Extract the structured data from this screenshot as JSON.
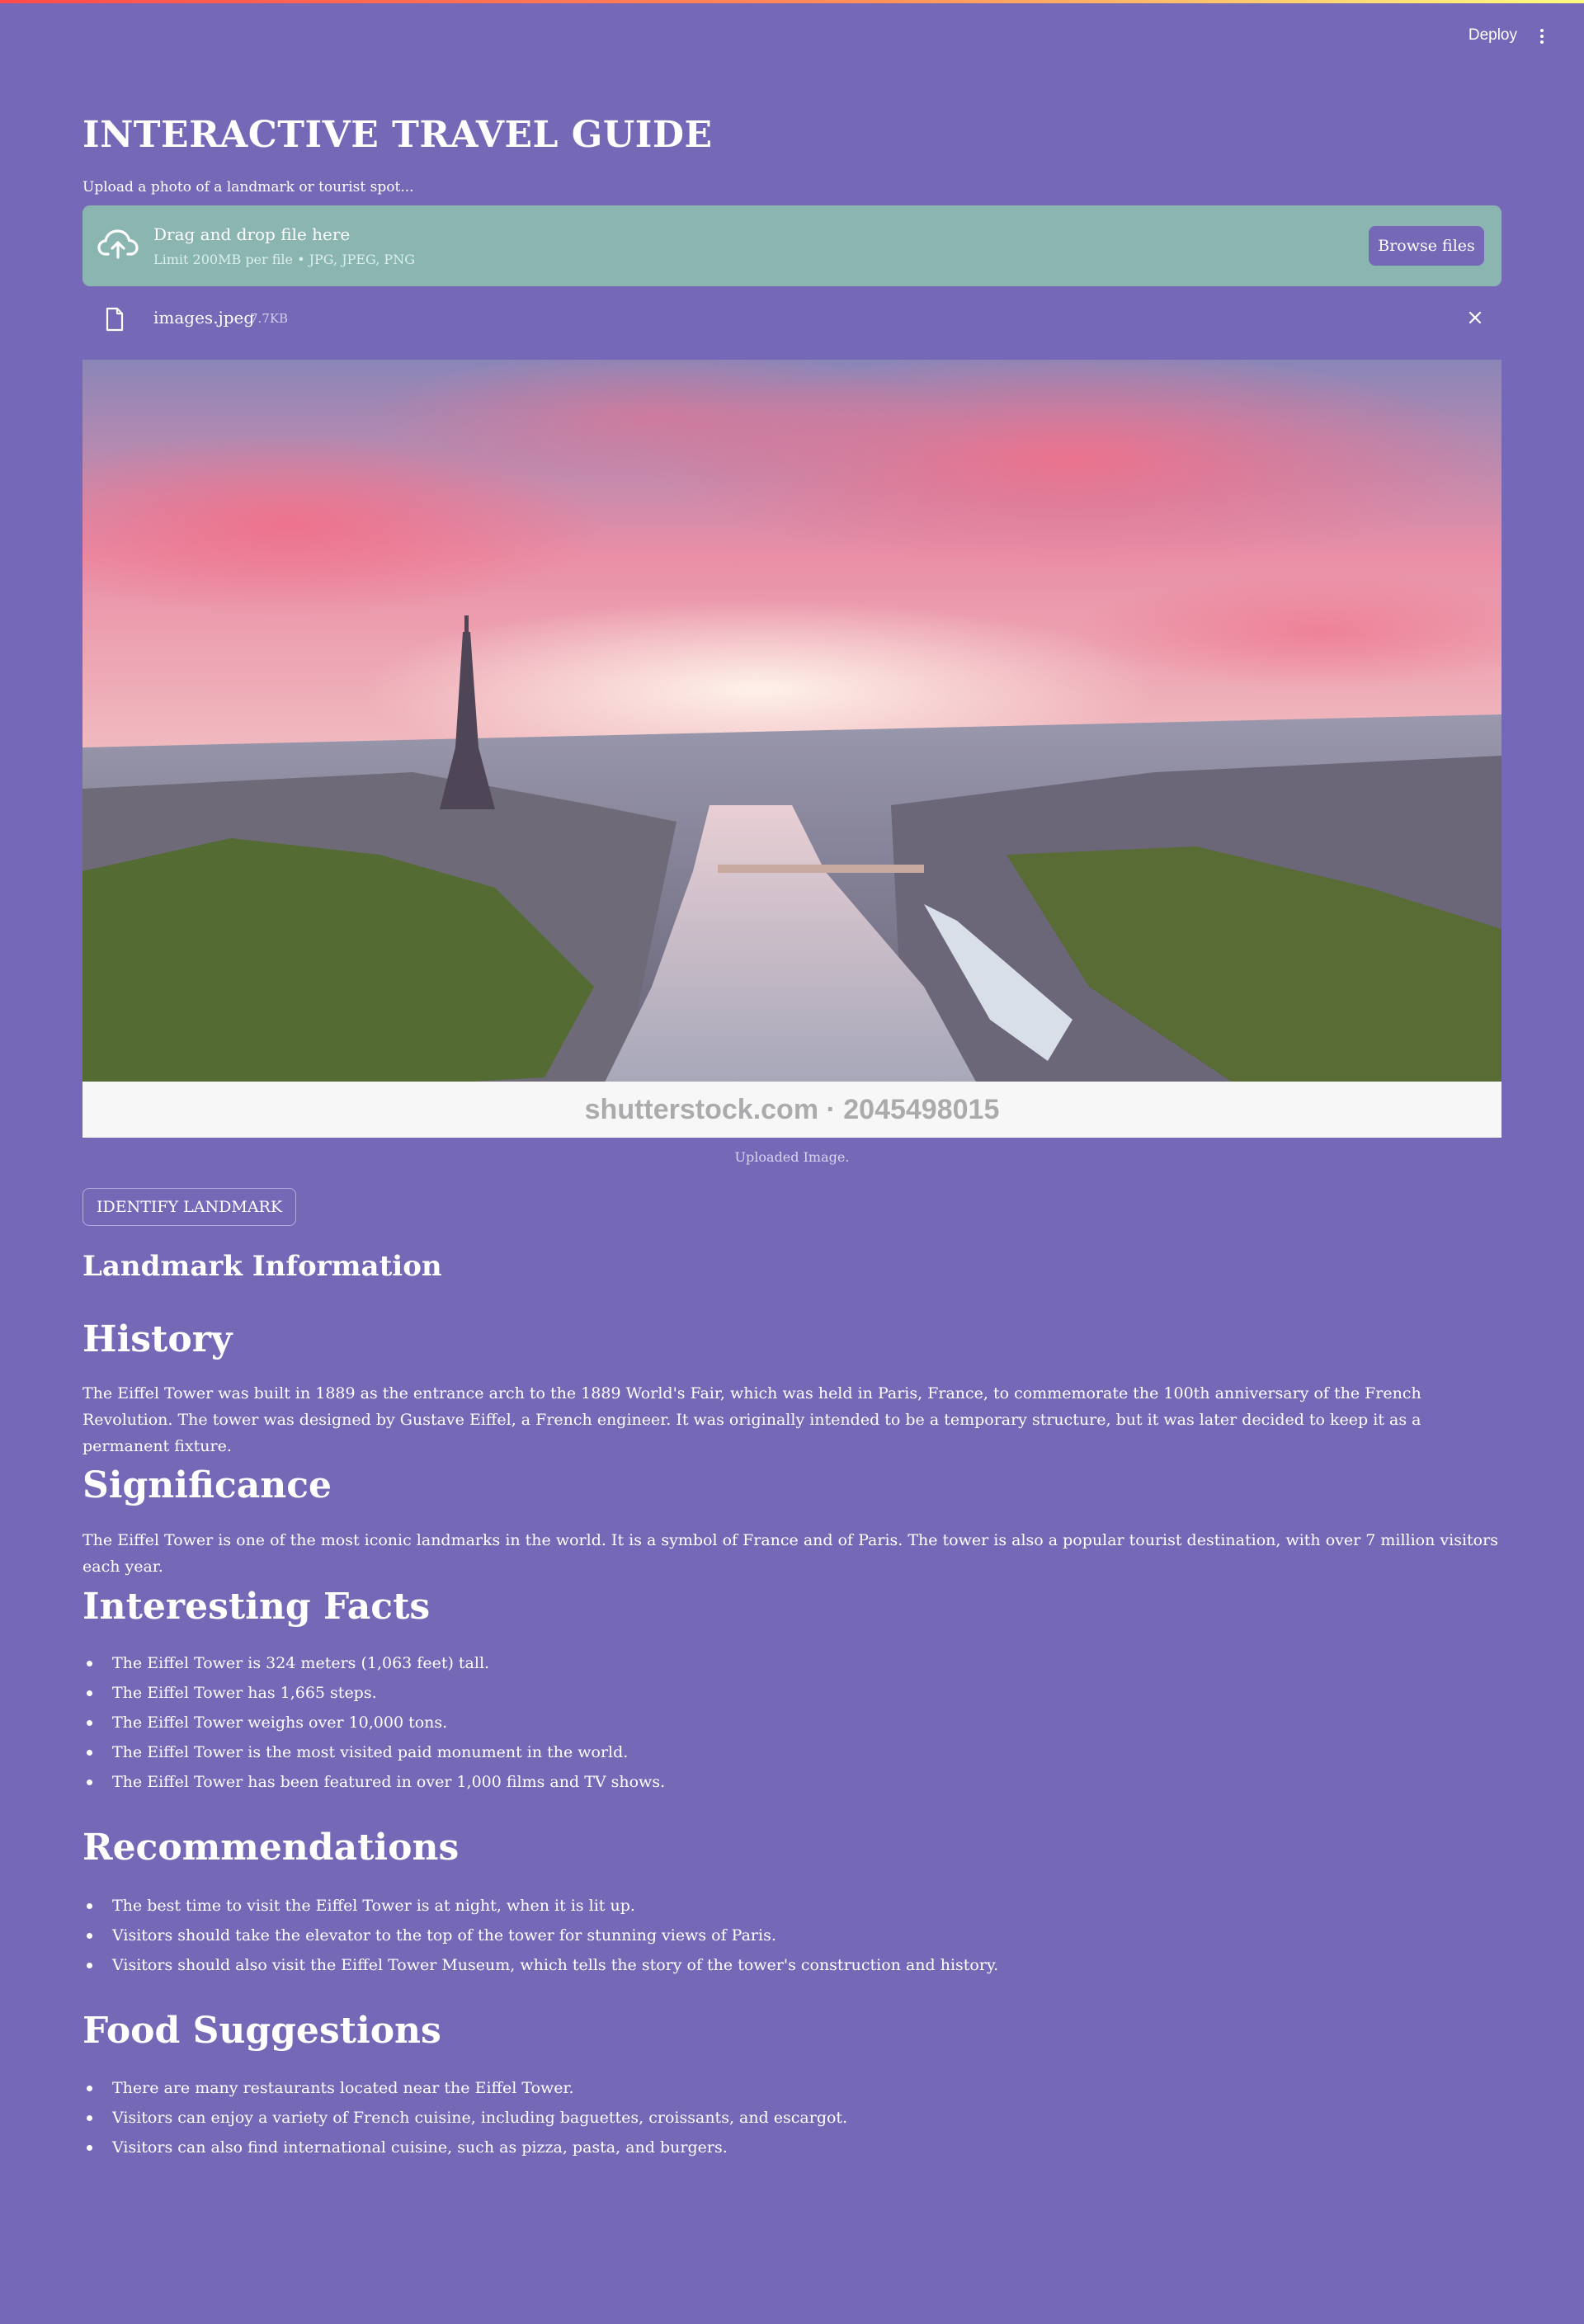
{
  "header": {
    "deploy_label": "Deploy",
    "menu_icon": "vertical-ellipsis-icon"
  },
  "page": {
    "title": "INTERACTIVE TRAVEL GUIDE",
    "upload_label": "Upload a photo of a landmark or tourist spot..."
  },
  "uploader": {
    "title": "Drag and drop file here",
    "subtitle": "Limit 200MB per file • JPG, JPEG, PNG",
    "browse_label": "Browse files",
    "icon": "cloud-upload-icon"
  },
  "file": {
    "name": "images.jpeg",
    "size": "7.7KB",
    "icon": "file-icon",
    "remove_icon": "close-icon"
  },
  "image": {
    "watermark": "shutterstock.com · 2045498015",
    "caption": "Uploaded Image."
  },
  "actions": {
    "identify_label": "IDENTIFY LANDMARK"
  },
  "info": {
    "heading": "Landmark Information",
    "history": {
      "heading": "History",
      "text": "The Eiffel Tower was built in 1889 as the entrance arch to the 1889 World's Fair, which was held in Paris, France, to commemorate the 100th anniversary of the French Revolution. The tower was designed by Gustave Eiffel, a French engineer. It was originally intended to be a temporary structure, but it was later decided to keep it as a permanent fixture."
    },
    "significance": {
      "heading": "Significance",
      "text": "The Eiffel Tower is one of the most iconic landmarks in the world. It is a symbol of France and of Paris. The tower is also a popular tourist destination, with over 7 million visitors each year."
    },
    "facts": {
      "heading": "Interesting Facts",
      "items": [
        "The Eiffel Tower is 324 meters (1,063 feet) tall.",
        "The Eiffel Tower has 1,665 steps.",
        "The Eiffel Tower weighs over 10,000 tons.",
        "The Eiffel Tower is the most visited paid monument in the world.",
        "The Eiffel Tower has been featured in over 1,000 films and TV shows."
      ]
    },
    "recommendations": {
      "heading": "Recommendations",
      "items": [
        "The best time to visit the Eiffel Tower is at night, when it is lit up.",
        "Visitors should take the elevator to the top of the tower for stunning views of Paris.",
        "Visitors should also visit the Eiffel Tower Museum, which tells the story of the tower's construction and history."
      ]
    },
    "food": {
      "heading": "Food Suggestions",
      "items": [
        "There are many restaurants located near the Eiffel Tower.",
        "Visitors can enjoy a variety of French cuisine, including baguettes, croissants, and escargot.",
        "Visitors can also find international cuisine, such as pizza, pasta, and burgers."
      ]
    }
  }
}
